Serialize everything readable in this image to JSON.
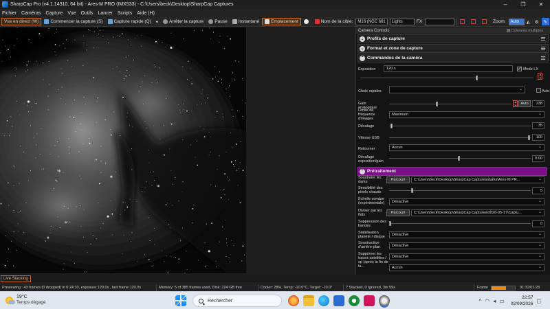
{
  "window": {
    "title": "SharpCap Pro (v4.1.14310, 64 bit) - Ares-M PRO (IMX533) - C:\\Users\\beck\\Desktop\\SharpCap Captures",
    "controls": [
      "–",
      "❐",
      "✕"
    ]
  },
  "menu": [
    "Fichier",
    "Caméras",
    "Capture",
    "Vue",
    "Outils",
    "Lancer",
    "Scripts",
    "Aide (H)"
  ],
  "toolbar": {
    "live_view": "Vue en direct (W)",
    "start_capture": "Commencer la capture (S)",
    "quick_capture": "Capture rapide (Q)",
    "stop_capture": "Arrêter la capture",
    "pause": "Pause",
    "snapshot": "Instantané",
    "framing": "Emplacement",
    "target_label": "Nom de la cible:",
    "target_value": "M16 (NGC 661",
    "frame_type": "Lights",
    "fx_label": "FX",
    "zoom_label": "Zoom:",
    "zoom_value": "Auto"
  },
  "panel": {
    "header": "Camera Controls",
    "multi_columns": "Colonnes multiples",
    "sections": {
      "profiles": "Profils de capture",
      "format": "Format et zone de capture",
      "camera_controls": "Commandes de la caméra",
      "preprocessing": "Prétraitement"
    },
    "camera": {
      "exposure_label": "Exposition",
      "exposure_value": "120 s",
      "lx_mode": "Mode LX",
      "quick_choices_label": "Choix rapides",
      "auto_label": "Auto",
      "gain_label": "Gain analogique",
      "gain_auto": "Auto",
      "gain_value": "238",
      "freq_label": "Limite de fréquence d'images",
      "freq_value": "Maximum",
      "offset_label": "Décalage",
      "offset_value": "35",
      "usb_label": "Vitesse USB",
      "usb_value": "100",
      "flip_label": "Retourner",
      "flip_value": "Aucun",
      "expgain_label": "Décalage exposition/gain",
      "expgain_value": "0.00"
    },
    "preprocessing": {
      "subtract_darks_label": "Soustraire les darks",
      "subtract_darks_btn": "Parcouri",
      "subtract_darks_path": "C:\\Users\\beck\\Desktop\\SharpCap Captures\\darks\\Ares-M PR...",
      "hotpix_label": "Sensibilité des pixels chauds",
      "hotpix_value": "5",
      "dark_scale_label": "Échelle sombre (expérimentale)",
      "dark_scale_value": "Désactivé",
      "flats_label": "Diviser par les flats",
      "flats_btn": "Parcouri",
      "flats_path": "C:\\Users\\beck\\Desktop\\SharpCap Captures\\2026-05-17\\Captu...",
      "banding_label": "Suppression des bandes",
      "banding_value": "0",
      "stabilize_label": "Stabilisation planète / disque",
      "stabilize_value": "Désactivé",
      "bg_sub_label": "Soustraction d'arrière-plan",
      "bg_sub_value": "Désactivé",
      "sat_label": "Supprimer les traces satellites / sp (après la fin de la...",
      "sat_value": "Désactivé",
      "extra_value": "Aucun"
    }
  },
  "live_stacking_tab": "Live Stacking",
  "status": {
    "preview": "Previewing : 43 frames (0 dropped) in 0:24:10, exposure 120.0s , last frame 120.0s",
    "memory": "Memory: 5 of 385 frames used, Disk: 224 GB free",
    "cooler": "Cooler: 28%, Temp: -10.0°C, Target: -10.0°",
    "stacked": "7 Stacked, 0 Ignored, 3m 59s",
    "frame_label": "Frame",
    "frame_time": "01:32/02:28",
    "frame_progress": 0.62
  },
  "taskbar": {
    "temp": "19°C",
    "weather": "Temps dégagé",
    "search": "Rechercher",
    "time": "22:57",
    "date": "02/09/2026"
  }
}
